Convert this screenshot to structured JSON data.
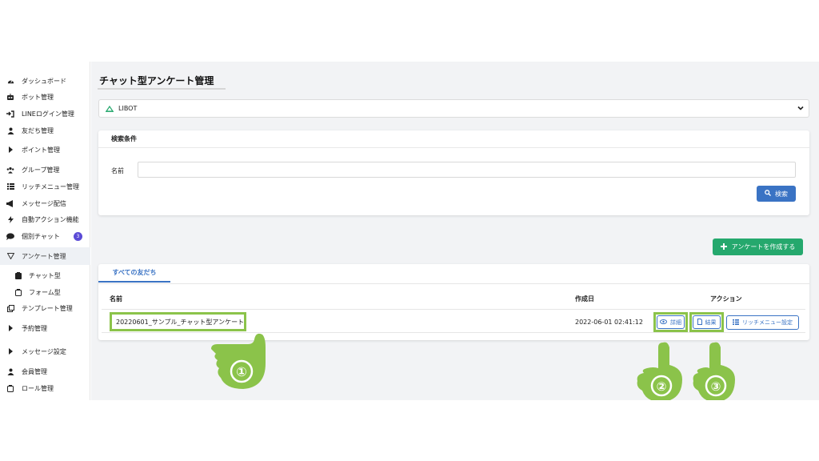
{
  "sidebar": {
    "items": [
      {
        "label": "ダッシュボード",
        "icon": "dashboard-icon"
      },
      {
        "label": "ボット管理",
        "icon": "robot-icon"
      },
      {
        "label": "LINEログイン管理",
        "icon": "sign-in-icon"
      },
      {
        "label": "友だち管理",
        "icon": "user-icon"
      },
      {
        "label": "ポイント管理",
        "icon": "caret-right-icon"
      },
      {
        "label": "グループ管理",
        "icon": "users-icon"
      },
      {
        "label": "リッチメニュー管理",
        "icon": "list-icon"
      },
      {
        "label": "メッセージ配信",
        "icon": "megaphone-icon"
      },
      {
        "label": "自動アクション機能",
        "icon": "bolt-icon"
      },
      {
        "label": "個別チャット",
        "icon": "chat-icon",
        "badge": "3"
      },
      {
        "label": "アンケート管理",
        "icon": "chevron-down-outline-icon"
      },
      {
        "label": "チャット型",
        "icon": "clipboard-icon"
      },
      {
        "label": "フォーム型",
        "icon": "clipboard-outline-icon"
      },
      {
        "label": "テンプレート管理",
        "icon": "copy-icon"
      },
      {
        "label": "予約管理",
        "icon": "caret-right-icon"
      },
      {
        "label": "メッセージ設定",
        "icon": "caret-right-icon"
      },
      {
        "label": "会員管理",
        "icon": "user-icon"
      },
      {
        "label": "ロール管理",
        "icon": "clipboard-outline-icon"
      }
    ]
  },
  "main": {
    "title": "チャット型アンケート管理",
    "bot_select": {
      "value": "LIBOT"
    },
    "search": {
      "header": "検索条件",
      "name_label": "名前",
      "name_value": "",
      "button_label": "検索"
    },
    "create_button_label": "アンケートを作成する",
    "tabs": [
      {
        "label": "すべての友だち"
      }
    ],
    "table": {
      "headers": {
        "name": "名前",
        "created": "作成日",
        "action": "アクション"
      },
      "rows": [
        {
          "name": "20220601_サンプル_チャット型アンケート",
          "created": "2022-06-01 02:41:12"
        }
      ],
      "actions": {
        "detail": "詳細",
        "result": "結果",
        "richmenu": "リッチメニュー設定"
      }
    }
  },
  "annotations": {
    "one": "①",
    "two": "②",
    "three": "③"
  },
  "colors": {
    "accent": "#3a73c4",
    "create": "#25a86d",
    "highlight": "#8bc34a",
    "badge": "#5b4bd6"
  }
}
